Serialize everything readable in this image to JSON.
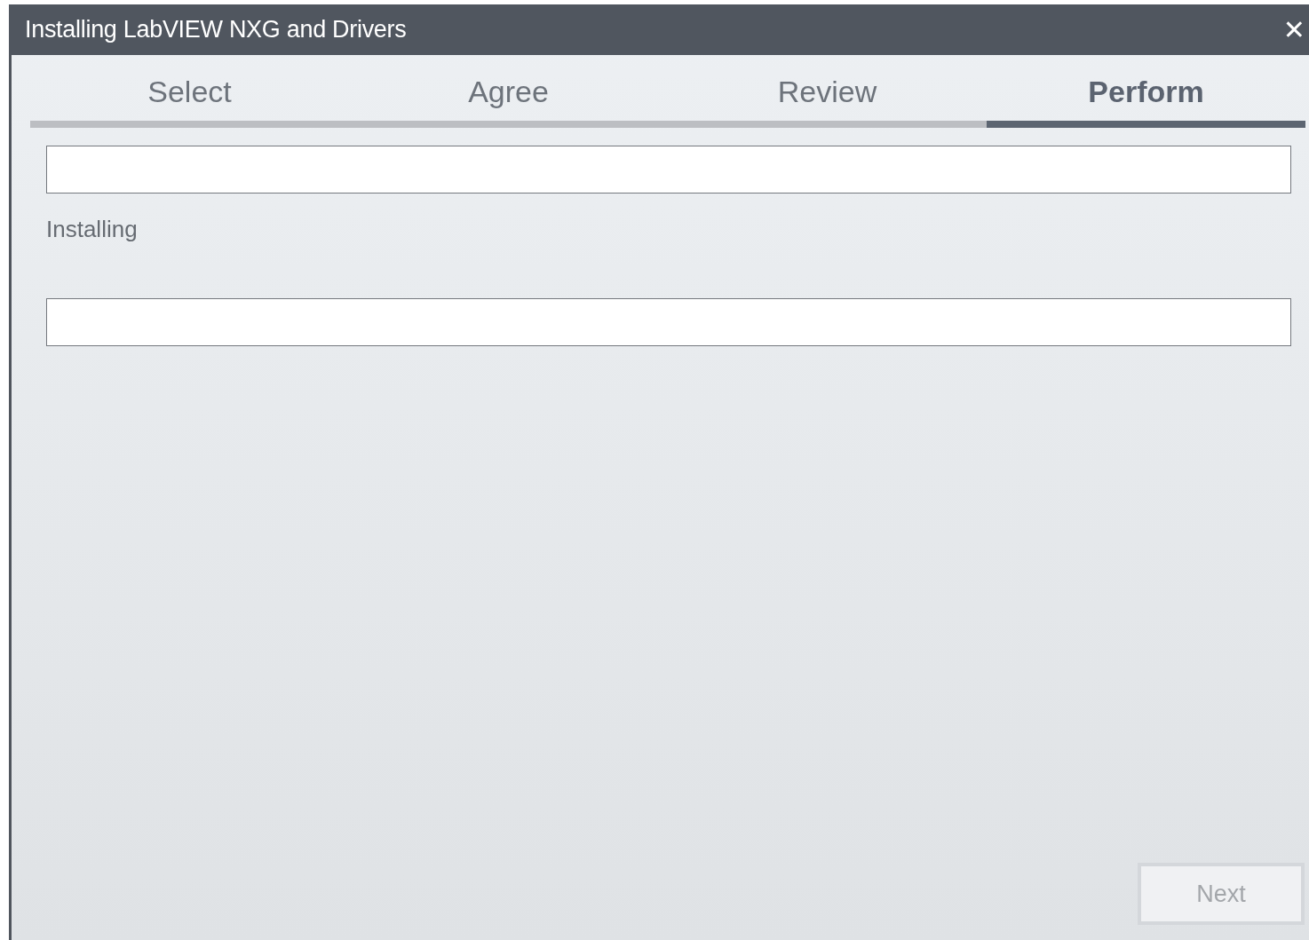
{
  "window": {
    "title": "Installing LabVIEW NXG and Drivers",
    "close": "✕"
  },
  "steps": [
    {
      "label": "Select",
      "selected": false
    },
    {
      "label": "Agree",
      "selected": false
    },
    {
      "label": "Review",
      "selected": false
    },
    {
      "label": "Perform",
      "selected": true
    }
  ],
  "status": "Installing",
  "buttons": [
    {
      "label": "Next",
      "disabled": true
    }
  ]
}
